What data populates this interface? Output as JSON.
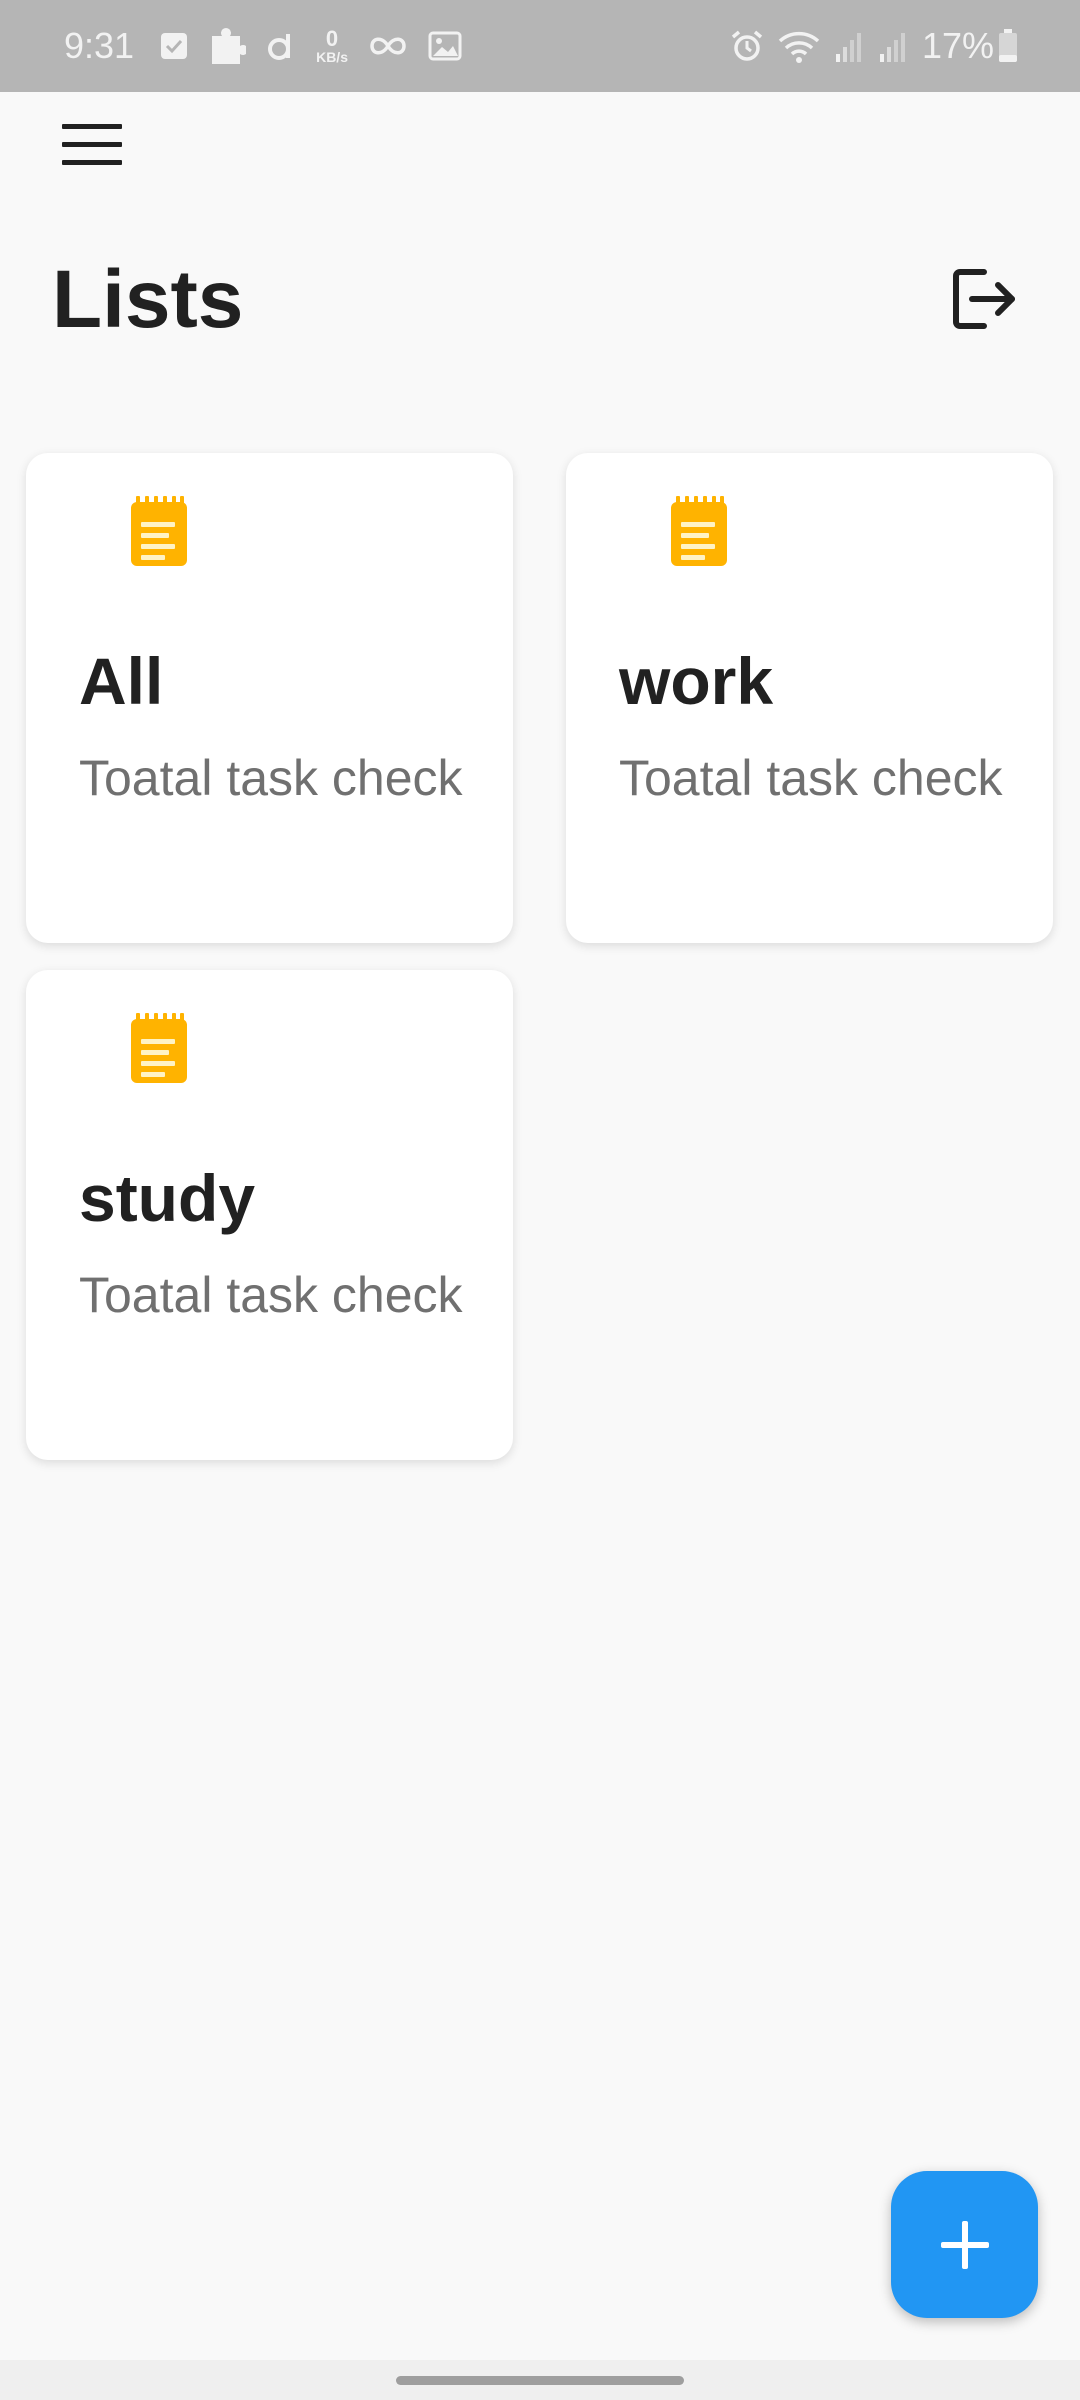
{
  "status_bar": {
    "time": "9:31",
    "network_speed_value": "0",
    "network_speed_unit": "KB/s",
    "battery_percent": "17%"
  },
  "header": {
    "title": "Lists",
    "menu_icon": "hamburger-menu-icon",
    "logout_icon": "logout-icon"
  },
  "lists": [
    {
      "name": "All",
      "subtitle": "Toatal task check",
      "icon": "notepad-icon"
    },
    {
      "name": "work",
      "subtitle": "Toatal task check",
      "icon": "notepad-icon"
    },
    {
      "name": "study",
      "subtitle": "Toatal task check",
      "icon": "notepad-icon"
    }
  ],
  "fab": {
    "icon": "plus-icon"
  },
  "colors": {
    "accent": "#2196f3",
    "icon_yellow": "#ffb300",
    "status_bar": "#b5b5b5",
    "background": "#f9f9f9"
  }
}
